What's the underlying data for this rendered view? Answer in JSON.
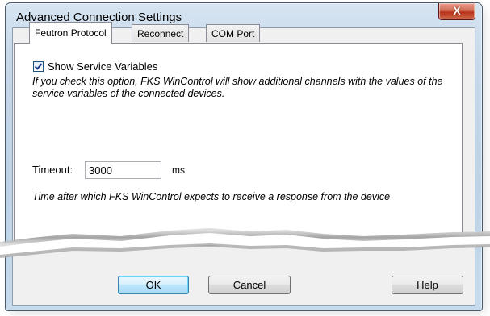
{
  "window": {
    "title": "Advanced Connection Settings",
    "close_symbol": "X"
  },
  "tabs": [
    {
      "label": "Feutron Protocol",
      "active": true
    },
    {
      "label": "Reconnect",
      "active": false
    },
    {
      "label": "COM Port",
      "active": false
    }
  ],
  "protocol": {
    "show_service_variables": {
      "label": "Show Service Variables",
      "checked": true
    },
    "service_variables_help": "If you check this option, FKS WinControl will show additional channels with the values of the service variables of the connected devices.",
    "timeout": {
      "label": "Timeout:",
      "value": "3000",
      "unit": "ms"
    },
    "timeout_help": "Time after which FKS WinControl expects to receive a response from the device"
  },
  "buttons": {
    "ok": "OK",
    "cancel": "Cancel",
    "help": "Help"
  },
  "colors": {
    "frame": "#c6d8ea",
    "close_button": "#c8452c",
    "default_button": "#bee6fd"
  }
}
